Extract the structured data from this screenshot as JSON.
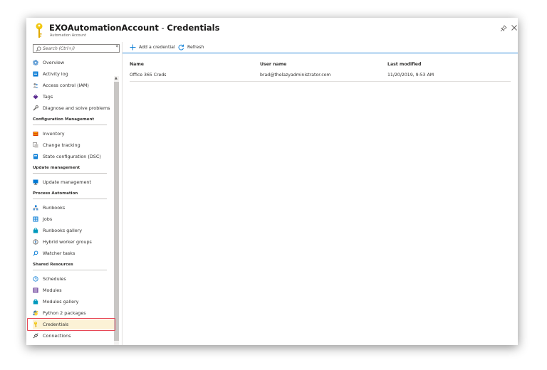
{
  "header": {
    "title_account": "EXOAutomationAccount",
    "title_sep": " - ",
    "title_page": "Credentials",
    "subtitle": "Automation Account"
  },
  "search": {
    "placeholder": "Search (Ctrl+/)"
  },
  "sidebar": {
    "collapse_label": "«",
    "top_items": [
      {
        "label": "Overview",
        "icon": "gear-icon"
      },
      {
        "label": "Activity log",
        "icon": "activity-log-icon"
      },
      {
        "label": "Access control (IAM)",
        "icon": "people-icon"
      },
      {
        "label": "Tags",
        "icon": "tag-icon"
      },
      {
        "label": "Diagnose and solve problems",
        "icon": "wrench-icon"
      }
    ],
    "sections": [
      {
        "title": "Configuration Management",
        "items": [
          {
            "label": "Inventory",
            "icon": "inventory-icon"
          },
          {
            "label": "Change tracking",
            "icon": "change-tracking-icon"
          },
          {
            "label": "State configuration (DSC)",
            "icon": "dsc-icon"
          }
        ]
      },
      {
        "title": "Update management",
        "items": [
          {
            "label": "Update management",
            "icon": "monitor-icon"
          }
        ]
      },
      {
        "title": "Process Automation",
        "items": [
          {
            "label": "Runbooks",
            "icon": "runbooks-icon"
          },
          {
            "label": "Jobs",
            "icon": "jobs-icon"
          },
          {
            "label": "Runbooks gallery",
            "icon": "bag-icon"
          },
          {
            "label": "Hybrid worker groups",
            "icon": "hybrid-icon"
          },
          {
            "label": "Watcher tasks",
            "icon": "magnifier-icon"
          }
        ]
      },
      {
        "title": "Shared Resources",
        "items": [
          {
            "label": "Schedules",
            "icon": "clock-icon"
          },
          {
            "label": "Modules",
            "icon": "modules-icon"
          },
          {
            "label": "Modules gallery",
            "icon": "bag-icon"
          },
          {
            "label": "Python 2 packages",
            "icon": "python-icon"
          },
          {
            "label": "Credentials",
            "icon": "key-icon",
            "selected": true
          },
          {
            "label": "Connections",
            "icon": "plug-icon"
          }
        ]
      }
    ]
  },
  "toolbar": {
    "add_label": "Add a credential",
    "refresh_label": "Refresh"
  },
  "grid": {
    "columns": [
      "Name",
      "User name",
      "Last modified"
    ],
    "rows": [
      [
        "Office 365 Creds",
        "brad@thelazyadministrator.com",
        "11/20/2019, 9:53 AM"
      ]
    ]
  },
  "colors": {
    "accent": "#0078d4",
    "selection_bg": "#fcf2d6",
    "highlight_border": "#e74856",
    "key_yellow": "#f2c811"
  }
}
